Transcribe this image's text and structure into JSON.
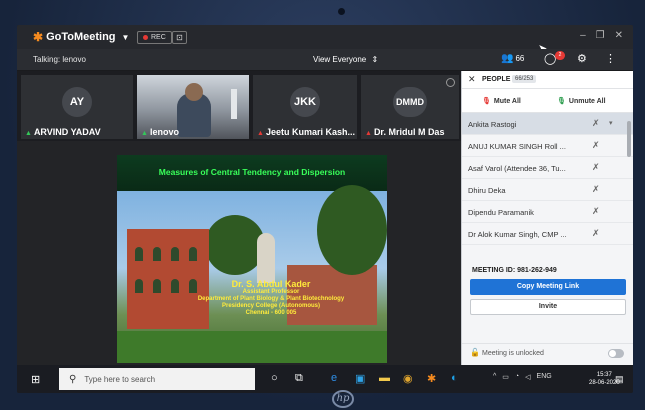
{
  "app": {
    "brand": "GoToMeeting",
    "rec_label": "REC",
    "talking": "Talking: lenovo",
    "view_mode": "View Everyone",
    "people_count": "66",
    "chat_badge": "2"
  },
  "webcams": [
    {
      "initials": "AY",
      "name": "ARVIND YADAV",
      "type": "avatar"
    },
    {
      "initials": "",
      "name": "lenovo",
      "type": "video"
    },
    {
      "initials": "JKK",
      "name": "Jeetu Kumari Kash...",
      "type": "avatar"
    },
    {
      "initials": "DMMD",
      "name": "Dr. Mridul M Das",
      "type": "avatar"
    }
  ],
  "slide": {
    "title": "Measures of Central Tendency and Dispersion",
    "author": "Dr. S. Abdul Kader",
    "lines": [
      "Assistant Professor",
      "Department of Plant Biology & Plant Biotechnology",
      "Presidency College (Autonomous)",
      "Chennai - 600 005"
    ]
  },
  "people_panel": {
    "title": "PEOPLE",
    "count": "66/253",
    "mute_all": "Mute All",
    "unmute_all": "Unmute All",
    "attendees": [
      "Ankita Rastogi",
      "ANUJ KUMAR SINGH Roll ...",
      "Asaf Varol (Attendee 36, Tu...",
      "Dhiru Deka",
      "Dipendu Paramanik",
      "Dr Alok Kumar Singh, CMP ..."
    ],
    "meeting_id_label": "MEETING ID:",
    "meeting_id": "981-262-949",
    "copy_link": "Copy Meeting Link",
    "invite": "Invite",
    "lock_status": "Meeting is unlocked"
  },
  "taskbar": {
    "search_placeholder": "Type here to search",
    "lang": "ENG",
    "time": "15:37",
    "date": "28-06-2020"
  },
  "device": {
    "logo": "hp"
  }
}
